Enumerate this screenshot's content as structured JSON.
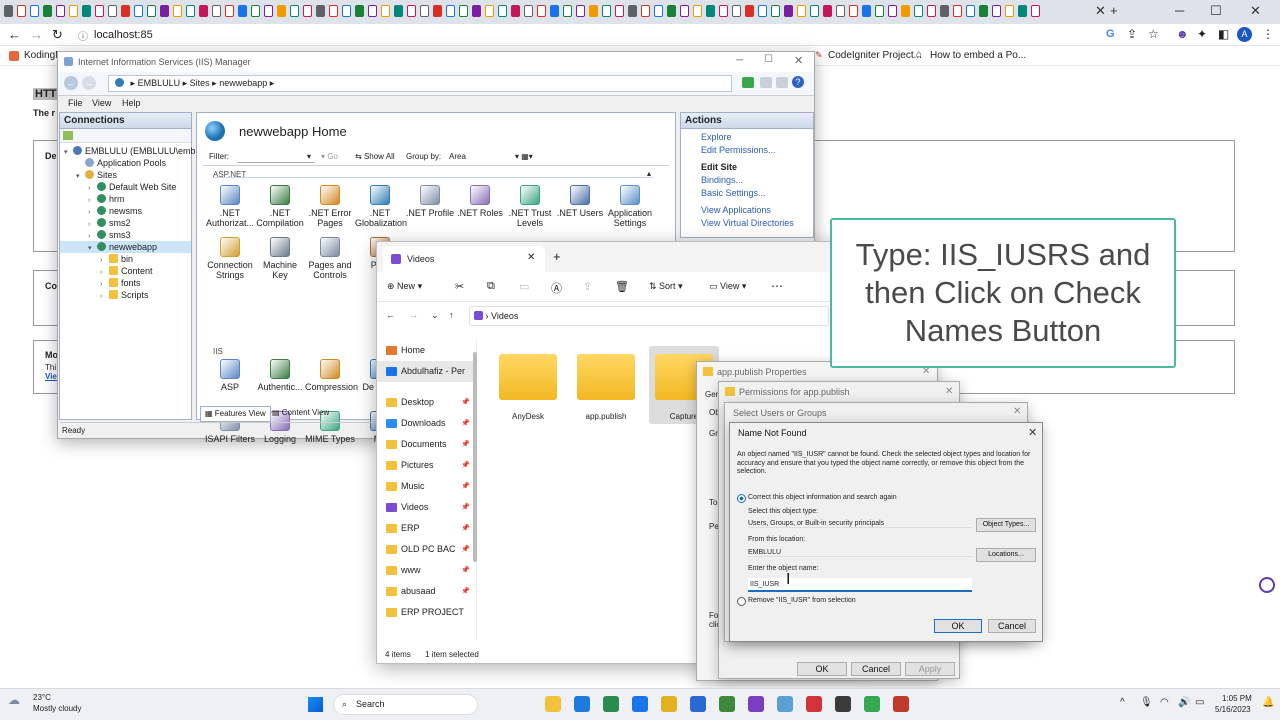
{
  "browser": {
    "url": "localhost:85",
    "bookmarks": [
      "KodingM",
      "CodeIgniter Project...",
      "How to embed a Po..."
    ],
    "profile_initial": "A"
  },
  "page": {
    "heading": "HTT",
    "subtext": "The r",
    "box1": "De",
    "box2": "Co",
    "box3_title": "Mo",
    "box3_line1": "Thi",
    "box3_link": "Vie"
  },
  "iis": {
    "title": "Internet Information Services (IIS) Manager",
    "breadcrumb": [
      "EMBLULU",
      "Sites",
      "newwebapp"
    ],
    "menu": [
      "File",
      "View",
      "Help"
    ],
    "connections_label": "Connections",
    "tree": [
      {
        "label": "EMBLULU (EMBLULU\\emblulu",
        "indent": 0,
        "color": "#4b78b8"
      },
      {
        "label": "Application Pools",
        "indent": 1,
        "color": "#8aa6c9"
      },
      {
        "label": "Sites",
        "indent": 1,
        "color": "#e0b040"
      },
      {
        "label": "Default Web Site",
        "indent": 2,
        "color": "#2f8f5f"
      },
      {
        "label": "hrm",
        "indent": 2,
        "color": "#2f8f5f"
      },
      {
        "label": "newsms",
        "indent": 2,
        "color": "#2f8f5f"
      },
      {
        "label": "sms2",
        "indent": 2,
        "color": "#2f8f5f"
      },
      {
        "label": "sms3",
        "indent": 2,
        "color": "#2f8f5f"
      },
      {
        "label": "newwebapp",
        "indent": 2,
        "color": "#2f8f5f"
      },
      {
        "label": "bin",
        "indent": 3,
        "color": "#f3c23c"
      },
      {
        "label": "Content",
        "indent": 3,
        "color": "#f3c23c"
      },
      {
        "label": "fonts",
        "indent": 3,
        "color": "#f3c23c"
      },
      {
        "label": "Scripts",
        "indent": 3,
        "color": "#f3c23c"
      }
    ],
    "home_title": "newwebapp Home",
    "filter_label": "Filter:",
    "go_label": "Go",
    "show_all_label": "Show All",
    "group_by_label": "Group by:",
    "group_by_value": "Area",
    "section_aspnet": "ASP.NET",
    "section_iis": "IIS",
    "features_aspnet": [
      ".NET Authorizat...",
      ".NET Compilation",
      ".NET Error Pages",
      ".NET Globalization",
      ".NET Profile",
      ".NET Roles",
      ".NET Trust Levels",
      ".NET Users",
      "Application Settings",
      "Connection Strings",
      "Machine Key",
      "Pages and Controls",
      "Prov"
    ],
    "features_iis": [
      "ASP",
      "Authentic...",
      "Compression",
      "De Docu",
      "ISAPI Filters",
      "Logging",
      "MIME Types",
      "Mo"
    ],
    "tab_features": "Features View",
    "tab_content": "Content View",
    "status": "Ready",
    "actions_label": "Actions",
    "actions": [
      {
        "label": "Explore",
        "header": false
      },
      {
        "label": "Edit Permissions...",
        "header": false
      },
      {
        "label": "Edit Site",
        "header": true
      },
      {
        "label": "Bindings...",
        "header": false
      },
      {
        "label": "Basic Settings...",
        "header": false
      },
      {
        "label": "View Applications",
        "header": false
      },
      {
        "label": "View Virtual Directories",
        "header": false
      }
    ]
  },
  "explorer": {
    "tab_title": "Videos",
    "new_label": "New",
    "sort_label": "Sort",
    "view_label": "View",
    "path": "Videos",
    "nav": [
      {
        "label": "Home",
        "pin": false
      },
      {
        "label": "Abdulhafiz - Per",
        "pin": false
      },
      {
        "label": "Desktop",
        "pin": true
      },
      {
        "label": "Downloads",
        "pin": true
      },
      {
        "label": "Documents",
        "pin": true
      },
      {
        "label": "Pictures",
        "pin": true
      },
      {
        "label": "Music",
        "pin": true
      },
      {
        "label": "Videos",
        "pin": true
      },
      {
        "label": "ERP",
        "pin": true
      },
      {
        "label": "OLD PC BAC",
        "pin": true
      },
      {
        "label": "www",
        "pin": true
      },
      {
        "label": "abusaad",
        "pin": true
      },
      {
        "label": "ERP PROJECT",
        "pin": false
      }
    ],
    "folders": [
      "AnyDesk",
      "app.publish",
      "Capture"
    ],
    "status_items": "4 items",
    "status_selected": "1 item selected"
  },
  "properties": {
    "title": "app.publish Properties",
    "tab_gen": "Gen",
    "side_labels": [
      "Ob",
      "Gr",
      "To",
      "Pe",
      "Fo",
      "clic"
    ]
  },
  "permissions": {
    "title": "Permissions for app.publish",
    "ok": "OK",
    "cancel": "Cancel",
    "apply": "Apply"
  },
  "select_users": {
    "title": "Select Users or Groups"
  },
  "name_not_found": {
    "title": "Name Not Found",
    "message": "An object named \"IIS_IUSR\" cannot be found. Check the selected object types and location for accuracy and ensure that you typed the object name correctly, or remove this object from the selection.",
    "radio_correct": "Correct this object information and search again",
    "object_type_label": "Select this object type:",
    "object_type_value": "Users, Groups, or Built-in security principals",
    "object_types_button": "Object Types...",
    "location_label": "From this location:",
    "location_value": "EMBLULU",
    "locations_button": "Locations...",
    "object_name_label": "Enter the object name:",
    "object_name_value": "IIS_IUSR",
    "radio_remove": "Remove \"IIS_IUSR\" from selection",
    "ok": "OK",
    "cancel": "Cancel"
  },
  "callout": {
    "text": "Type: IIS_IUSRS and then Click on Check Names Button"
  },
  "taskbar": {
    "weather_temp": "23°C",
    "weather_desc": "Mostly cloudy",
    "search_label": "Search",
    "time": "1:05 PM",
    "date": "5/16/2023"
  }
}
